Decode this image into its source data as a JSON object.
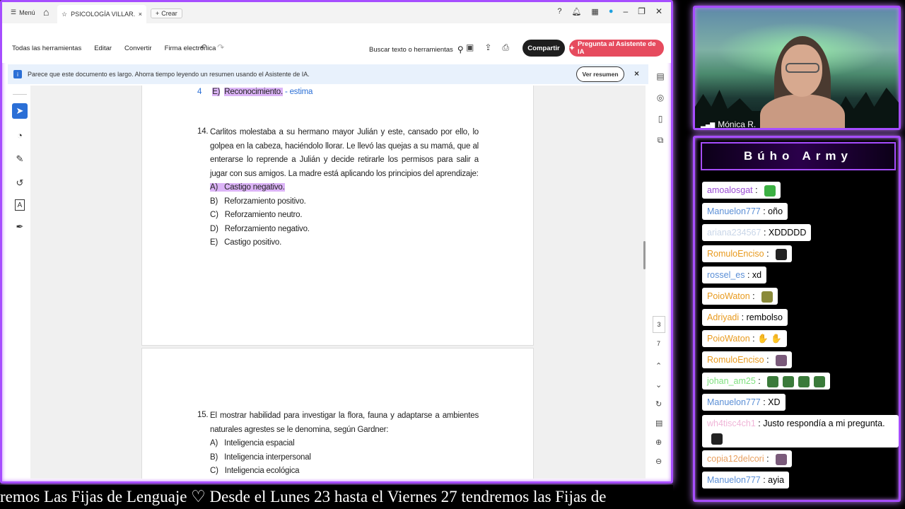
{
  "acrobat": {
    "tabbar": {
      "menu_label": "Menú",
      "tab_title": "PSICOLOGÍA VILLAR...",
      "create_label": "Crear"
    },
    "toolbar": {
      "all_tools": "Todas las herramientas",
      "edit": "Editar",
      "convert": "Convertir",
      "esign": "Firma electrónica",
      "search_text": "Buscar texto o herramientas",
      "share_label": "Compartir",
      "ask_ai_label": "Pregunta al Asistente de IA"
    },
    "notice": {
      "text": "Parece que este documento es largo. Ahorra tiempo leyendo un resumen usando el Asistente de IA.",
      "button": "Ver resumen"
    },
    "page_nav": {
      "current": "3",
      "total": "7"
    }
  },
  "document": {
    "prev_item": {
      "num": "4",
      "letter": "E)",
      "answer": "Reconocimiento.",
      "note": "- estima"
    },
    "q14": {
      "number": "14.",
      "text": "Carlitos molestaba a su hermano mayor Julián y este, cansado por ello, lo golpea en la cabeza, haciéndolo llorar. Le llevó las quejas a su mamá, que al enterarse lo reprende a Julián y decide retirarle los permisos para salir a jugar con sus amigos. La madre está aplicando los principios del aprendizaje:",
      "options": [
        {
          "letter": "A)",
          "text": "Castigo negativo."
        },
        {
          "letter": "B)",
          "text": "Reforzamiento positivo."
        },
        {
          "letter": "C)",
          "text": "Reforzamiento neutro."
        },
        {
          "letter": "D)",
          "text": "Reforzamiento negativo."
        },
        {
          "letter": "E)",
          "text": "Castigo positivo."
        }
      ]
    },
    "q15": {
      "number": "15.",
      "text": "El mostrar habilidad para investigar la flora, fauna y adaptarse a ambientes naturales agrestes se le denomina, según Gardner:",
      "options": [
        {
          "letter": "A)",
          "text": "Inteligencia espacial"
        },
        {
          "letter": "B)",
          "text": "Inteligencia interpersonal"
        },
        {
          "letter": "C)",
          "text": "Inteligencia ecológica"
        }
      ]
    }
  },
  "ticker": {
    "text": "remos Las Fijas de Lenguaje    ♡    Desde el Lunes 23 hasta el Viernes 27 tendremos las Fijas de"
  },
  "webcam": {
    "name": "Mónica R."
  },
  "chat": {
    "title": "Búho Army",
    "messages": [
      {
        "user": "amoalosgat",
        "color": "#9b4dd4",
        "text": "",
        "emote": "#3cb043"
      },
      {
        "user": "Manuelon777",
        "color": "#5b8fd6",
        "text": "oño"
      },
      {
        "user": "ariana234567",
        "color": "#c9d6e8",
        "text": "XDDDDD"
      },
      {
        "user": "RomuloEnciso",
        "color": "#e89a1e",
        "text": "",
        "emote": "#222222"
      },
      {
        "user": "rossel_es",
        "color": "#5b8fd6",
        "text": "xd"
      },
      {
        "user": "PoioWaton",
        "color": "#e89a1e",
        "text": "",
        "emote": "#8a8a3a"
      },
      {
        "user": "Adriyadi",
        "color": "#e89a1e",
        "text": "rembolso"
      },
      {
        "user": "PoioWaton",
        "color": "#e89a1e",
        "text": "✋ ✋"
      },
      {
        "user": "RomuloEnciso",
        "color": "#e89a1e",
        "text": "",
        "emote": "#7a5a7a"
      },
      {
        "user": "johan_am25",
        "color": "#7ee07e",
        "text": "",
        "emote": "#3a7a3a"
      },
      {
        "user": "Manuelon777",
        "color": "#5b8fd6",
        "text": "XD"
      },
      {
        "user": "wh4tisc4ch1",
        "color": "#f0b6d8",
        "text": "Justo respondía a mi pregunta.",
        "emote": "#222222"
      },
      {
        "user": "copia12delcori",
        "color": "#e8a060",
        "text": "",
        "emote": "#7a5a7a"
      },
      {
        "user": "Manuelon777",
        "color": "#5b8fd6",
        "text": "ayia"
      }
    ]
  }
}
